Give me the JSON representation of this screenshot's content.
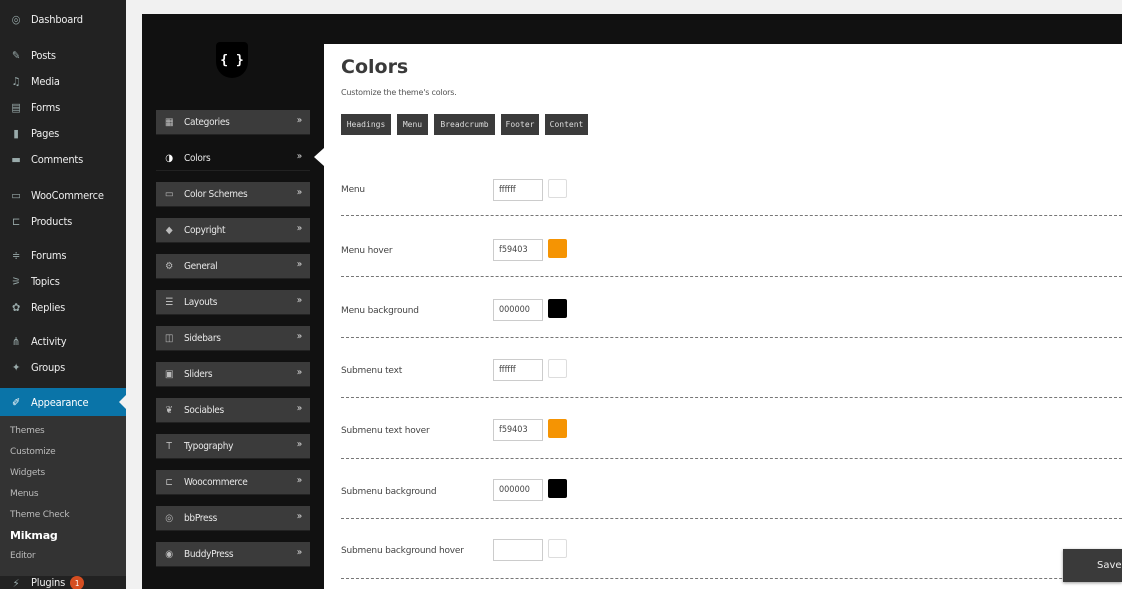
{
  "wp_menu": {
    "items": [
      {
        "label": "Dashboard",
        "icon": "dashboard-icon"
      },
      {
        "label": "Posts",
        "icon": "pin-icon"
      },
      {
        "label": "Media",
        "icon": "media-icon"
      },
      {
        "label": "Forms",
        "icon": "forms-icon"
      },
      {
        "label": "Pages",
        "icon": "pages-icon"
      },
      {
        "label": "Comments",
        "icon": "comment-icon"
      },
      {
        "label": "WooCommerce",
        "icon": "woo-icon"
      },
      {
        "label": "Products",
        "icon": "cart-icon"
      },
      {
        "label": "Forums",
        "icon": "forums-icon"
      },
      {
        "label": "Topics",
        "icon": "topics-icon"
      },
      {
        "label": "Replies",
        "icon": "replies-icon"
      },
      {
        "label": "Activity",
        "icon": "activity-icon"
      },
      {
        "label": "Groups",
        "icon": "groups-icon"
      },
      {
        "label": "Appearance",
        "icon": "brush-icon"
      }
    ],
    "submenu": [
      "Themes",
      "Customize",
      "Widgets",
      "Menus",
      "Theme Check",
      "Mikmag",
      "Editor"
    ],
    "plugins": {
      "label": "Plugins",
      "badge": "1"
    }
  },
  "theme_panel": {
    "logo_text": "{ }",
    "nav": [
      {
        "label": "Categories",
        "icon": "grid-icon"
      },
      {
        "label": "Colors",
        "icon": "contrast-icon"
      },
      {
        "label": "Color Schemes",
        "icon": "monitor-icon"
      },
      {
        "label": "Copyright",
        "icon": "tag-icon"
      },
      {
        "label": "General",
        "icon": "gears-icon"
      },
      {
        "label": "Layouts",
        "icon": "list-icon"
      },
      {
        "label": "Sidebars",
        "icon": "sidebar-icon"
      },
      {
        "label": "Sliders",
        "icon": "image-icon"
      },
      {
        "label": "Sociables",
        "icon": "bird-icon"
      },
      {
        "label": "Typography",
        "icon": "text-size-icon"
      },
      {
        "label": "Woocommerce",
        "icon": "cart-icon"
      },
      {
        "label": "bbPress",
        "icon": "bbpress-icon"
      },
      {
        "label": "BuddyPress",
        "icon": "buddypress-icon"
      }
    ],
    "chevron": "»"
  },
  "content": {
    "title": "Colors",
    "subtitle": "Customize the theme's colors.",
    "tabs": [
      "Headings",
      "Menu",
      "Breadcrumb",
      "Footer",
      "Content"
    ],
    "rows": [
      {
        "label": "Menu",
        "value": "ffffff",
        "color": "#ffffff"
      },
      {
        "label": "Menu hover",
        "value": "f59403",
        "color": "#f59403"
      },
      {
        "label": "Menu background",
        "value": "000000",
        "color": "#000000"
      },
      {
        "label": "Submenu text",
        "value": "ffffff",
        "color": "#ffffff"
      },
      {
        "label": "Submenu text hover",
        "value": "f59403",
        "color": "#f59403"
      },
      {
        "label": "Submenu background",
        "value": "000000",
        "color": "#000000"
      },
      {
        "label": "Submenu background hover",
        "value": "",
        "color": "#ffffff"
      }
    ],
    "save_label": "Save ch"
  },
  "colors": {
    "accent": "#0a74a8",
    "orange": "#f59403",
    "panel_dark": "#111111",
    "nav_item": "#3b3b3b"
  }
}
